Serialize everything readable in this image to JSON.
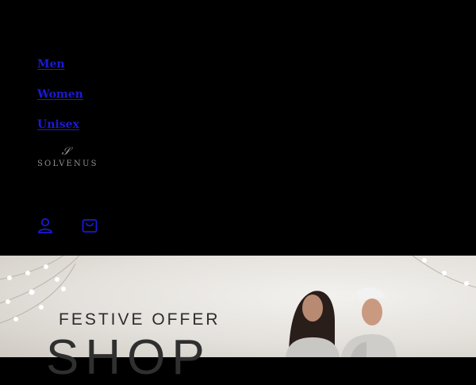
{
  "nav": {
    "items": [
      {
        "label": "Men"
      },
      {
        "label": "Women"
      },
      {
        "label": "Unisex"
      }
    ]
  },
  "logo": {
    "mark": "𝒮",
    "wordmark": "SOLVENUS"
  },
  "header_icons": [
    "account-icon",
    "cart-icon"
  ],
  "banner": {
    "headline": "FESTIVE OFFER",
    "big_text": "SHOP"
  },
  "colors": {
    "header_bg": "#000000",
    "nav_link": "#1a1ad6",
    "banner_bg": "#e8e5e0",
    "banner_text": "#2c2c2c"
  }
}
